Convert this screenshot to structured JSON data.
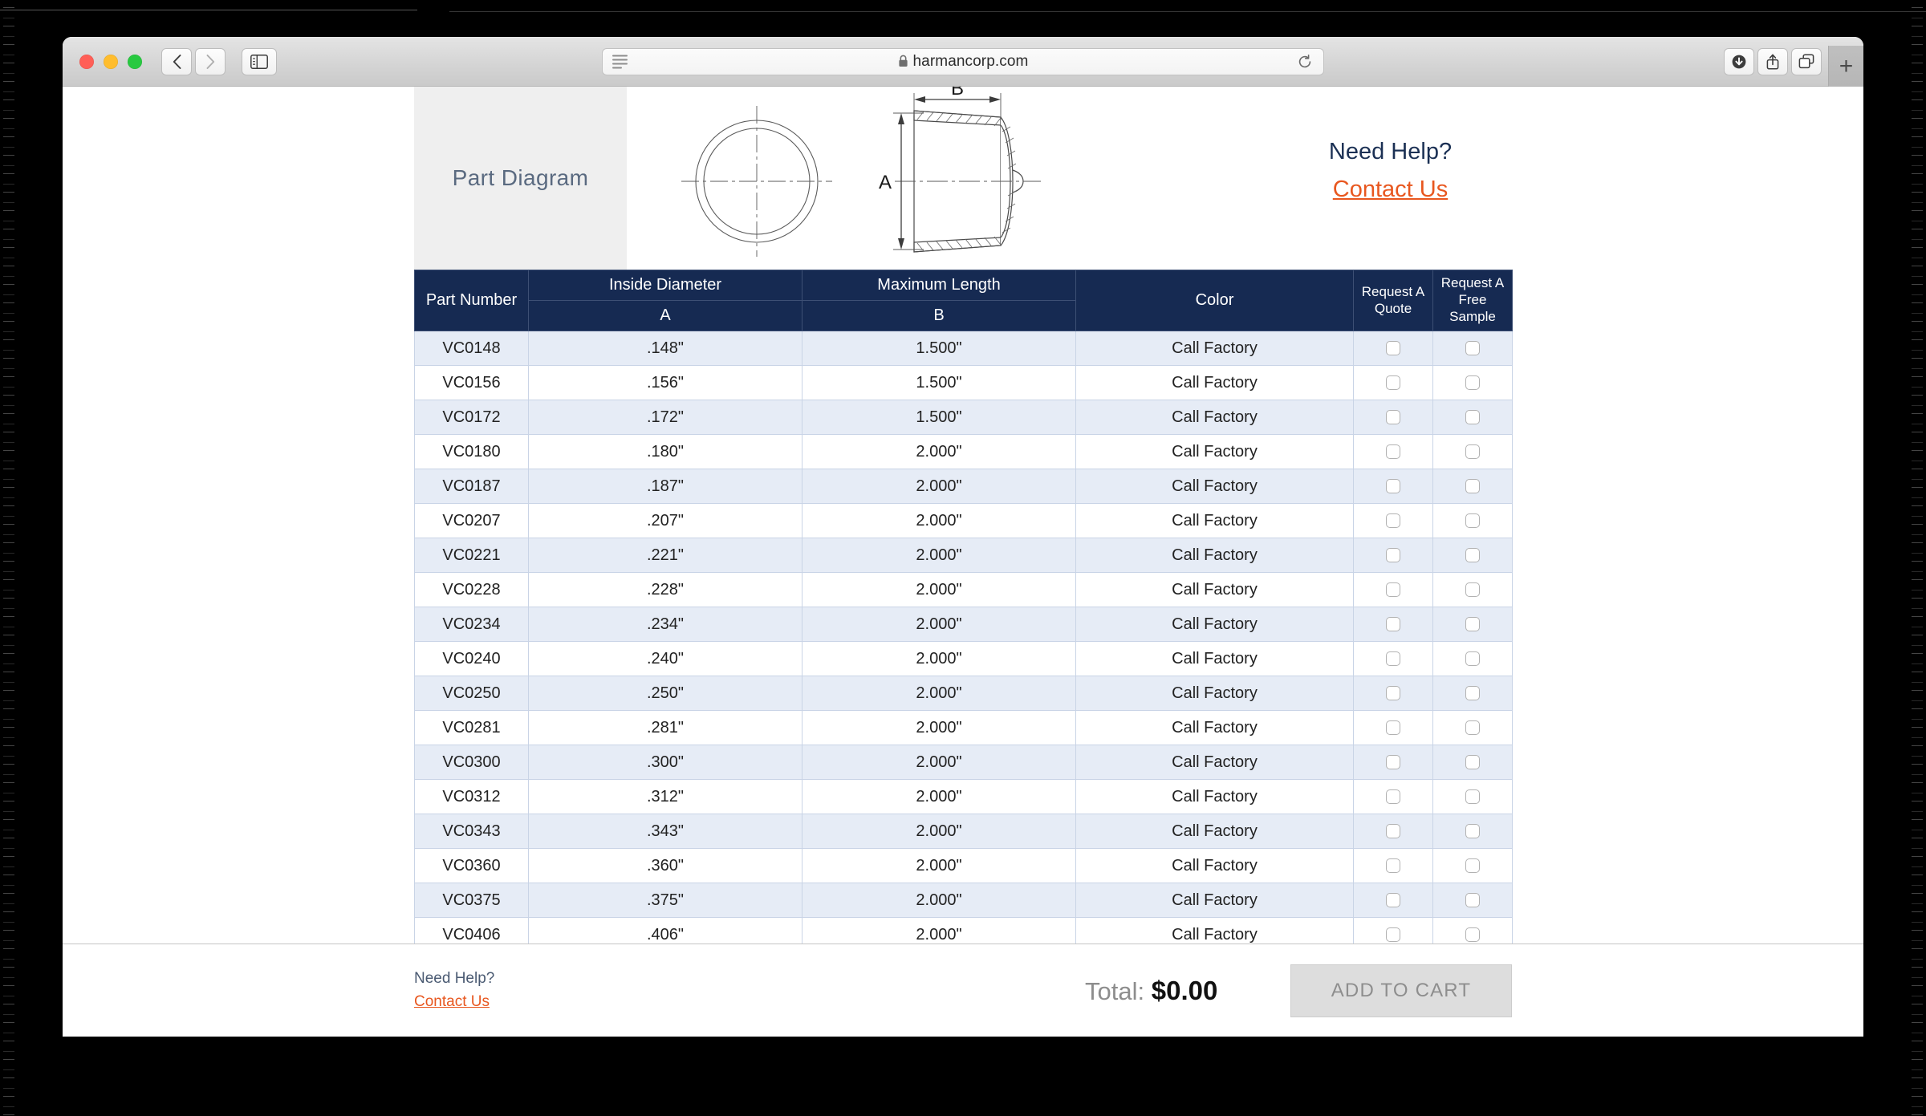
{
  "browser": {
    "url": "harmancorp.com",
    "secure_icon": "lock-icon",
    "back_icon": "chevron-left-icon",
    "forward_icon": "chevron-right-icon",
    "sidebar_icon": "sidebar-toggle-icon",
    "reader_icon": "reader-view-icon",
    "reload_icon": "reload-icon",
    "downloads_icon": "downloads-icon",
    "share_icon": "share-icon",
    "tabs_icon": "tab-overview-icon",
    "newtab_label": "+"
  },
  "diagram": {
    "label": "Part Diagram",
    "dim_a": "A",
    "dim_b": "B"
  },
  "help": {
    "title": "Need Help?",
    "link": "Contact Us"
  },
  "table": {
    "headers": {
      "part_number": "Part Number",
      "inside_diameter": "Inside Diameter",
      "inside_diameter_sub": "A",
      "maximum_length": "Maximum Length",
      "maximum_length_sub": "B",
      "color": "Color",
      "request_quote": "Request A Quote",
      "request_sample": "Request A Free Sample"
    },
    "rows": [
      {
        "part": "VC0148",
        "a": ".148\"",
        "b": "1.500\"",
        "color": "Call Factory",
        "quote": false,
        "sample": false
      },
      {
        "part": "VC0156",
        "a": ".156\"",
        "b": "1.500\"",
        "color": "Call Factory",
        "quote": false,
        "sample": false
      },
      {
        "part": "VC0172",
        "a": ".172\"",
        "b": "1.500\"",
        "color": "Call Factory",
        "quote": false,
        "sample": false
      },
      {
        "part": "VC0180",
        "a": ".180\"",
        "b": "2.000\"",
        "color": "Call Factory",
        "quote": false,
        "sample": false
      },
      {
        "part": "VC0187",
        "a": ".187\"",
        "b": "2.000\"",
        "color": "Call Factory",
        "quote": false,
        "sample": false
      },
      {
        "part": "VC0207",
        "a": ".207\"",
        "b": "2.000\"",
        "color": "Call Factory",
        "quote": false,
        "sample": false
      },
      {
        "part": "VC0221",
        "a": ".221\"",
        "b": "2.000\"",
        "color": "Call Factory",
        "quote": false,
        "sample": false
      },
      {
        "part": "VC0228",
        "a": ".228\"",
        "b": "2.000\"",
        "color": "Call Factory",
        "quote": false,
        "sample": false
      },
      {
        "part": "VC0234",
        "a": ".234\"",
        "b": "2.000\"",
        "color": "Call Factory",
        "quote": false,
        "sample": false
      },
      {
        "part": "VC0240",
        "a": ".240\"",
        "b": "2.000\"",
        "color": "Call Factory",
        "quote": false,
        "sample": false
      },
      {
        "part": "VC0250",
        "a": ".250\"",
        "b": "2.000\"",
        "color": "Call Factory",
        "quote": false,
        "sample": false
      },
      {
        "part": "VC0281",
        "a": ".281\"",
        "b": "2.000\"",
        "color": "Call Factory",
        "quote": false,
        "sample": false
      },
      {
        "part": "VC0300",
        "a": ".300\"",
        "b": "2.000\"",
        "color": "Call Factory",
        "quote": false,
        "sample": false
      },
      {
        "part": "VC0312",
        "a": ".312\"",
        "b": "2.000\"",
        "color": "Call Factory",
        "quote": false,
        "sample": false
      },
      {
        "part": "VC0343",
        "a": ".343\"",
        "b": "2.000\"",
        "color": "Call Factory",
        "quote": false,
        "sample": false
      },
      {
        "part": "VC0360",
        "a": ".360\"",
        "b": "2.000\"",
        "color": "Call Factory",
        "quote": false,
        "sample": false
      },
      {
        "part": "VC0375",
        "a": ".375\"",
        "b": "2.000\"",
        "color": "Call Factory",
        "quote": false,
        "sample": false
      },
      {
        "part": "VC0406",
        "a": ".406\"",
        "b": "2.000\"",
        "color": "Call Factory",
        "quote": false,
        "sample": false
      }
    ]
  },
  "footer": {
    "help_title": "Need Help?",
    "help_link": "Contact Us",
    "total_label": "Total:",
    "total_value": "$0.00",
    "add_to_cart": "ADD TO CART"
  },
  "colors": {
    "navy": "#162a52",
    "orange": "#e8571f",
    "row_alt": "#e6ecf6",
    "grid": "#c9d4e6"
  }
}
